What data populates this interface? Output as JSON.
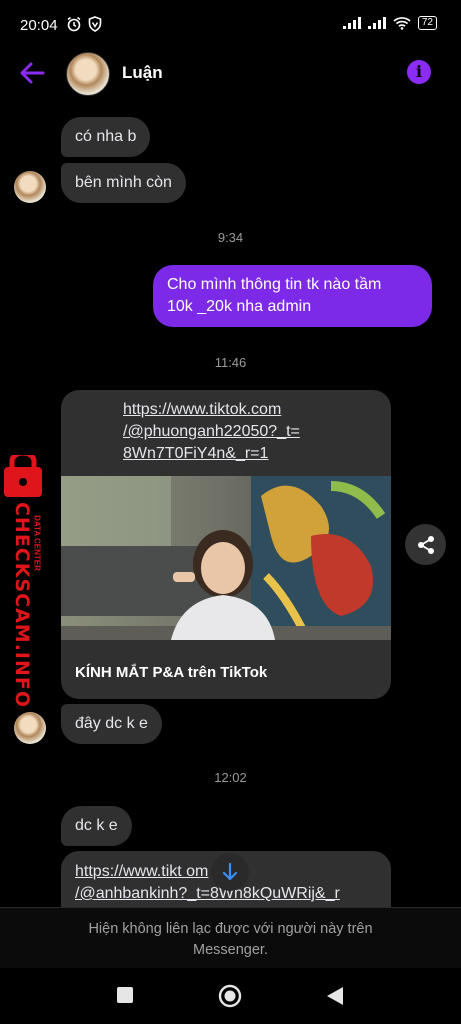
{
  "status_bar": {
    "time": "20:04",
    "battery": "72"
  },
  "header": {
    "contact_name": "Luận"
  },
  "messages": {
    "m1": "có nha b",
    "m2": "bên mình còn",
    "time1": "9:34",
    "m3_line1": "Cho mình thông tin tk nào tầm",
    "m3_line2": "10k _20k nha admin",
    "time2": "11:46",
    "link1_line1": "https://www.tiktok.com",
    "link1_line2": "/@phuonganh22050?_t=",
    "link1_line3": "8Wn7T0FiY4n&_r=1",
    "link1_caption": "KÍNH MẮT P&A trên TikTok",
    "m4": "đây dc k e",
    "time3": "12:02",
    "m5": "dc k e",
    "link2_line1": "https://www.tikt    om",
    "link2_line2": "/@anhbankinh?_t=8Wn8kQuWRij&_r"
  },
  "footer": {
    "line1": "Hiện không liên lạc được với người này trên",
    "line2": "Messenger."
  },
  "watermark": {
    "top": "DATA CENTER",
    "brand": "CHECKSCAM.INFO"
  },
  "colors": {
    "accent": "#8b2cf5",
    "outgoing": "#7d2ae8",
    "incoming": "#303030",
    "watermark": "#e0151b"
  }
}
